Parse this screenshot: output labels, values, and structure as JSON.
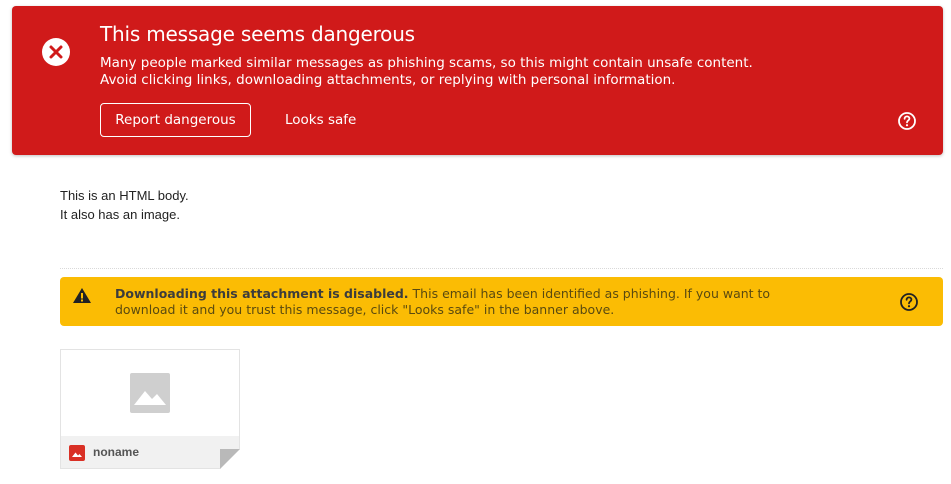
{
  "danger_banner": {
    "title": "This message seems dangerous",
    "description": "Many people marked similar messages as phishing scams, so this might contain unsafe content. Avoid clicking links, downloading attachments, or replying with personal information.",
    "report_button_label": "Report dangerous",
    "looks_safe_button_label": "Looks safe",
    "icon": "error-circle-icon",
    "help_icon": "help-circle-icon",
    "background_color": "#d01a1a"
  },
  "message_body": {
    "lines": [
      "This is an HTML body.",
      "It also has an image."
    ]
  },
  "attachment_warning": {
    "strong_text": "Downloading this attachment is disabled.",
    "text": "This email has been identified as phishing. If you want to download it and you trust this message, click \"Looks safe\" in the banner above.",
    "icon": "warning-triangle-icon",
    "help_icon": "help-circle-icon",
    "background_color": "#fbbc04"
  },
  "attachment": {
    "name": "noname",
    "thumbnail_icon": "image-placeholder-icon",
    "type_icon": "image-file-icon",
    "type_icon_color": "#d93025"
  }
}
